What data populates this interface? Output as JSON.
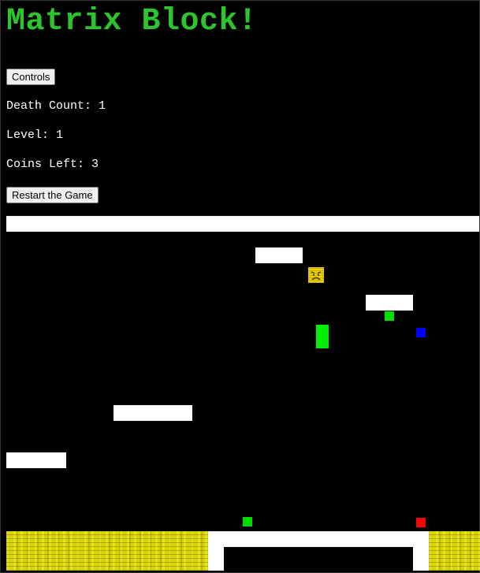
{
  "title": "Matrix Block!",
  "buttons": {
    "controls": "Controls",
    "restart": "Restart the Game"
  },
  "stats": {
    "death_count": "Death Count: 1",
    "level": "Level: 1",
    "coins_left": "Coins Left: 3"
  },
  "colors": {
    "title": "#2ec42e",
    "background": "#000000",
    "platform": "#ffffff",
    "coin": "#00dd00",
    "player": "#00ee00",
    "blue_block": "#0000ff",
    "red_block": "#ff0000",
    "lava": "#d9d400"
  },
  "game": {
    "coins_count": 3,
    "enemy_icon": "frowning-face-icon"
  }
}
